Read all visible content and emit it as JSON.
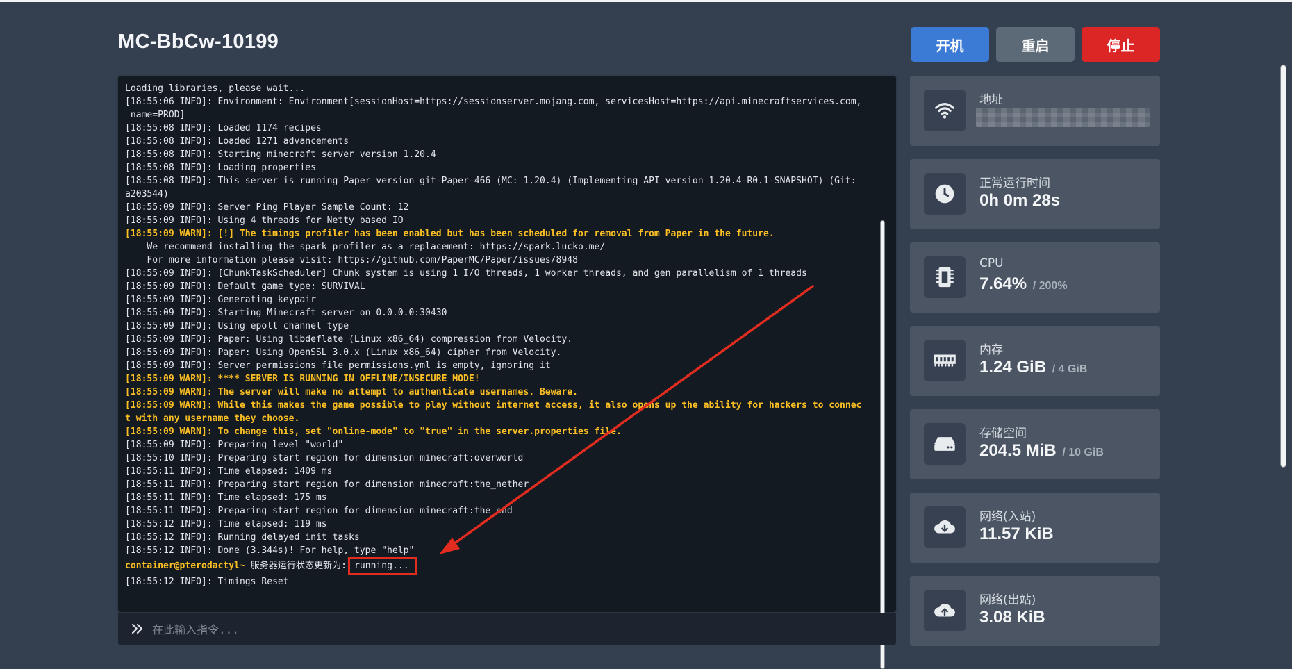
{
  "server": {
    "title": "MC-BbCw-10199"
  },
  "buttons": {
    "start": "开机",
    "restart": "重启",
    "stop": "停止"
  },
  "console": {
    "lines": [
      {
        "text": "Loading libraries, please wait...",
        "type": "info"
      },
      {
        "text": "[18:55:06 INFO]: Environment: Environment[sessionHost=https://sessionserver.mojang.com, servicesHost=https://api.minecraftservices.com,",
        "type": "info"
      },
      {
        "text": " name=PROD]",
        "type": "info"
      },
      {
        "text": "[18:55:08 INFO]: Loaded 1174 recipes",
        "type": "info"
      },
      {
        "text": "[18:55:08 INFO]: Loaded 1271 advancements",
        "type": "info"
      },
      {
        "text": "[18:55:08 INFO]: Starting minecraft server version 1.20.4",
        "type": "info"
      },
      {
        "text": "[18:55:08 INFO]: Loading properties",
        "type": "info"
      },
      {
        "text": "[18:55:08 INFO]: This server is running Paper version git-Paper-466 (MC: 1.20.4) (Implementing API version 1.20.4-R0.1-SNAPSHOT) (Git:",
        "type": "info"
      },
      {
        "text": "a203544)",
        "type": "info"
      },
      {
        "text": "[18:55:09 INFO]: Server Ping Player Sample Count: 12",
        "type": "info"
      },
      {
        "text": "[18:55:09 INFO]: Using 4 threads for Netty based IO",
        "type": "info"
      },
      {
        "text": "[18:55:09 WARN]: [!] The timings profiler has been enabled but has been scheduled for removal from Paper in the future.",
        "type": "warn"
      },
      {
        "text": "    We recommend installing the spark profiler as a replacement: https://spark.lucko.me/",
        "type": "info"
      },
      {
        "text": "    For more information please visit: https://github.com/PaperMC/Paper/issues/8948",
        "type": "info"
      },
      {
        "text": "[18:55:09 INFO]: [ChunkTaskScheduler] Chunk system is using 1 I/O threads, 1 worker threads, and gen parallelism of 1 threads",
        "type": "info"
      },
      {
        "text": "[18:55:09 INFO]: Default game type: SURVIVAL",
        "type": "info"
      },
      {
        "text": "[18:55:09 INFO]: Generating keypair",
        "type": "info"
      },
      {
        "text": "[18:55:09 INFO]: Starting Minecraft server on 0.0.0.0:30430",
        "type": "info"
      },
      {
        "text": "[18:55:09 INFO]: Using epoll channel type",
        "type": "info"
      },
      {
        "text": "[18:55:09 INFO]: Paper: Using libdeflate (Linux x86_64) compression from Velocity.",
        "type": "info"
      },
      {
        "text": "[18:55:09 INFO]: Paper: Using OpenSSL 3.0.x (Linux x86_64) cipher from Velocity.",
        "type": "info"
      },
      {
        "text": "[18:55:09 INFO]: Server permissions file permissions.yml is empty, ignoring it",
        "type": "info"
      },
      {
        "text": "[18:55:09 WARN]: **** SERVER IS RUNNING IN OFFLINE/INSECURE MODE!",
        "type": "warn"
      },
      {
        "text": "[18:55:09 WARN]: The server will make no attempt to authenticate usernames. Beware.",
        "type": "warn"
      },
      {
        "text": "[18:55:09 WARN]: While this makes the game possible to play without internet access, it also opens up the ability for hackers to connec",
        "type": "warn"
      },
      {
        "text": "t with any username they choose.",
        "type": "warn"
      },
      {
        "text": "[18:55:09 WARN]: To change this, set \"online-mode\" to \"true\" in the server.properties file.",
        "type": "warn"
      },
      {
        "text": "[18:55:09 INFO]: Preparing level \"world\"",
        "type": "info"
      },
      {
        "text": "[18:55:10 INFO]: Preparing start region for dimension minecraft:overworld",
        "type": "info"
      },
      {
        "text": "[18:55:11 INFO]: Time elapsed: 1409 ms",
        "type": "info"
      },
      {
        "text": "[18:55:11 INFO]: Preparing start region for dimension minecraft:the_nether",
        "type": "info"
      },
      {
        "text": "[18:55:11 INFO]: Time elapsed: 175 ms",
        "type": "info"
      },
      {
        "text": "[18:55:11 INFO]: Preparing start region for dimension minecraft:the_end",
        "type": "info"
      },
      {
        "text": "[18:55:12 INFO]: Time elapsed: 119 ms",
        "type": "info"
      },
      {
        "text": "[18:55:12 INFO]: Running delayed init tasks",
        "type": "info"
      },
      {
        "text": "[18:55:12 INFO]: Done (3.344s)! For help, type \"help\"",
        "type": "info"
      }
    ],
    "prompt_user": "container@pterodactyl~",
    "prompt_message": " 服务器运行状态更新为:",
    "prompt_status": "running...",
    "after_lines": [
      {
        "text": "[18:55:12 INFO]: Timings Reset",
        "type": "info"
      }
    ],
    "input_placeholder": "在此输入指令..."
  },
  "stats": {
    "address": {
      "label": "地址",
      "icon": "wifi-icon"
    },
    "uptime": {
      "label": "正常运行时间",
      "value": "0h 0m 28s",
      "icon": "clock-icon"
    },
    "cpu": {
      "label": "CPU",
      "value": "7.64%",
      "limit": "/ 200%",
      "icon": "cpu-icon"
    },
    "memory": {
      "label": "内存",
      "value": "1.24 GiB",
      "limit": "/ 4 GiB",
      "icon": "memory-icon"
    },
    "storage": {
      "label": "存储空间",
      "value": "204.5 MiB",
      "limit": "/ 10 GiB",
      "icon": "hard-drive-icon"
    },
    "net_in": {
      "label": "网络(入站)",
      "value": "11.57 KiB",
      "icon": "cloud-download-icon"
    },
    "net_out": {
      "label": "网络(出站)",
      "value": "3.08 KiB",
      "icon": "cloud-upload-icon"
    }
  },
  "colors": {
    "background": "#344050",
    "console_bg": "#131a21",
    "warn": "#fbbf24",
    "start_button": "#3b7bd5",
    "restart_button": "#5c6976",
    "stop_button": "#dc2626",
    "annotation": "#e12c1f"
  }
}
